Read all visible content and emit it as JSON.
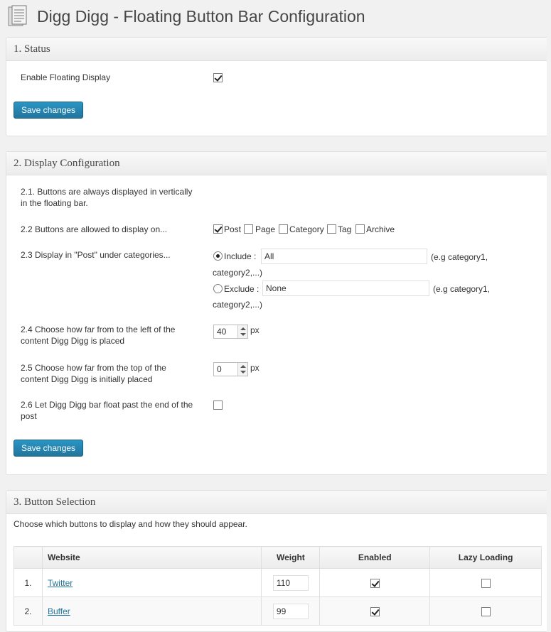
{
  "page": {
    "title": "Digg Digg - Floating Button Bar Configuration",
    "icon": "document-stack-icon"
  },
  "status": {
    "heading": "1. Status",
    "enable_label": "Enable Floating Display",
    "enable_checked": true,
    "save_label": "Save changes"
  },
  "display": {
    "heading": "2. Display Configuration",
    "s21_line1": "2.1. Buttons are always displayed in vertically",
    "s21_line2": "in the floating bar.",
    "s22_label": "2.2 Buttons are allowed to display on...",
    "s22_options": [
      {
        "label": "Post",
        "checked": true
      },
      {
        "label": "Page",
        "checked": false
      },
      {
        "label": "Category",
        "checked": false
      },
      {
        "label": "Tag",
        "checked": false
      },
      {
        "label": "Archive",
        "checked": false
      }
    ],
    "s23_label": "2.3 Display in \"Post\" under categories...",
    "include_label": "Include :",
    "include_value": "All",
    "include_hint": "(e.g category1,",
    "include_hint2": "category2,...)",
    "exclude_label": "Exclude :",
    "exclude_value": "None",
    "exclude_hint": "(e.g category1,",
    "exclude_hint2": "category2,...)",
    "s24_line1": "2.4 Choose how far from to the left of the",
    "s24_line2": "content Digg Digg is placed",
    "s24_value": "40",
    "s24_unit": "px",
    "s25_line1": "2.5 Choose how far from the top of the",
    "s25_line2": "content Digg Digg is initially placed",
    "s25_value": "0",
    "s25_unit": "px",
    "s26_line1": "2.6 Let Digg Digg bar float past the end of the",
    "s26_line2": "post",
    "s26_checked": false,
    "save_label": "Save changes"
  },
  "buttons": {
    "heading": "3. Button Selection",
    "intro": "Choose which buttons to display and how they should appear.",
    "columns": [
      "",
      "Website",
      "Weight",
      "Enabled",
      "Lazy Loading"
    ],
    "rows": [
      {
        "num": "1.",
        "site": "Twitter",
        "weight": "110",
        "enabled": true,
        "lazy": false
      },
      {
        "num": "2.",
        "site": "Buffer",
        "weight": "99",
        "enabled": true,
        "lazy": false
      }
    ]
  }
}
